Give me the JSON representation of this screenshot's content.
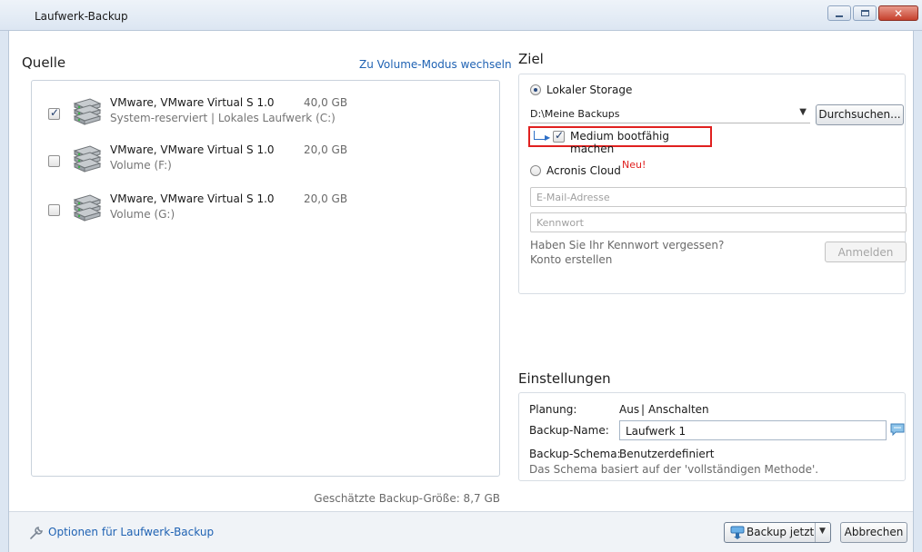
{
  "window": {
    "title": "Laufwerk-Backup",
    "close_glyph": "✕"
  },
  "source": {
    "heading": "Quelle",
    "mode_link": "Zu Volume-Modus wechseln",
    "drives": [
      {
        "name": "VMware, VMware Virtual S 1.0",
        "size": "40,0 GB",
        "subtitle": "System-reserviert | Lokales Laufwerk (C:)",
        "checked": true,
        "icon": "hard-disk-icon"
      },
      {
        "name": "VMware, VMware Virtual S 1.0",
        "size": "20,0 GB",
        "subtitle": "Volume (F:)",
        "checked": false,
        "icon": "hard-disk-icon"
      },
      {
        "name": "VMware, VMware Virtual S 1.0",
        "size": "20,0 GB",
        "subtitle": "Volume (G:)",
        "checked": false,
        "icon": "hard-disk-icon"
      }
    ],
    "estimated_size": "Geschätzte Backup-Größe: 8,7 GB"
  },
  "target": {
    "heading": "Ziel",
    "local_storage_label": "Lokaler Storage",
    "local_storage_selected": true,
    "path_value": "D:\\Meine Backups",
    "browse_label": "Durchsuchen...",
    "bootable_label": "Medium bootfähig machen",
    "bootable_checked": true,
    "cloud_label": "Acronis Cloud",
    "cloud_selected": false,
    "new_badge": "Neu!",
    "email_placeholder": "E-Mail-Adresse",
    "password_placeholder": "Kennwort",
    "forgot_password": "Haben Sie Ihr Kennwort vergessen?",
    "create_account": "Konto erstellen",
    "login_label": "Anmelden"
  },
  "settings": {
    "heading": "Einstellungen",
    "schedule_label": "Planung:",
    "schedule_value": "Aus",
    "schedule_separator": "|",
    "schedule_action": "Anschalten",
    "backup_name_label": "Backup-Name:",
    "backup_name_value": "Laufwerk 1",
    "scheme_label": "Backup-Schema:",
    "scheme_value": "Benutzerdefiniert",
    "scheme_description": "Das Schema basiert auf der 'vollständigen Methode'."
  },
  "footer": {
    "options_link": "Optionen für Laufwerk-Backup",
    "backup_now_label": "Backup jetzt",
    "cancel_label": "Abbrechen"
  },
  "colors": {
    "link": "#1f62b3",
    "highlight_border": "#e0201f",
    "new_badge": "#e0201f"
  }
}
